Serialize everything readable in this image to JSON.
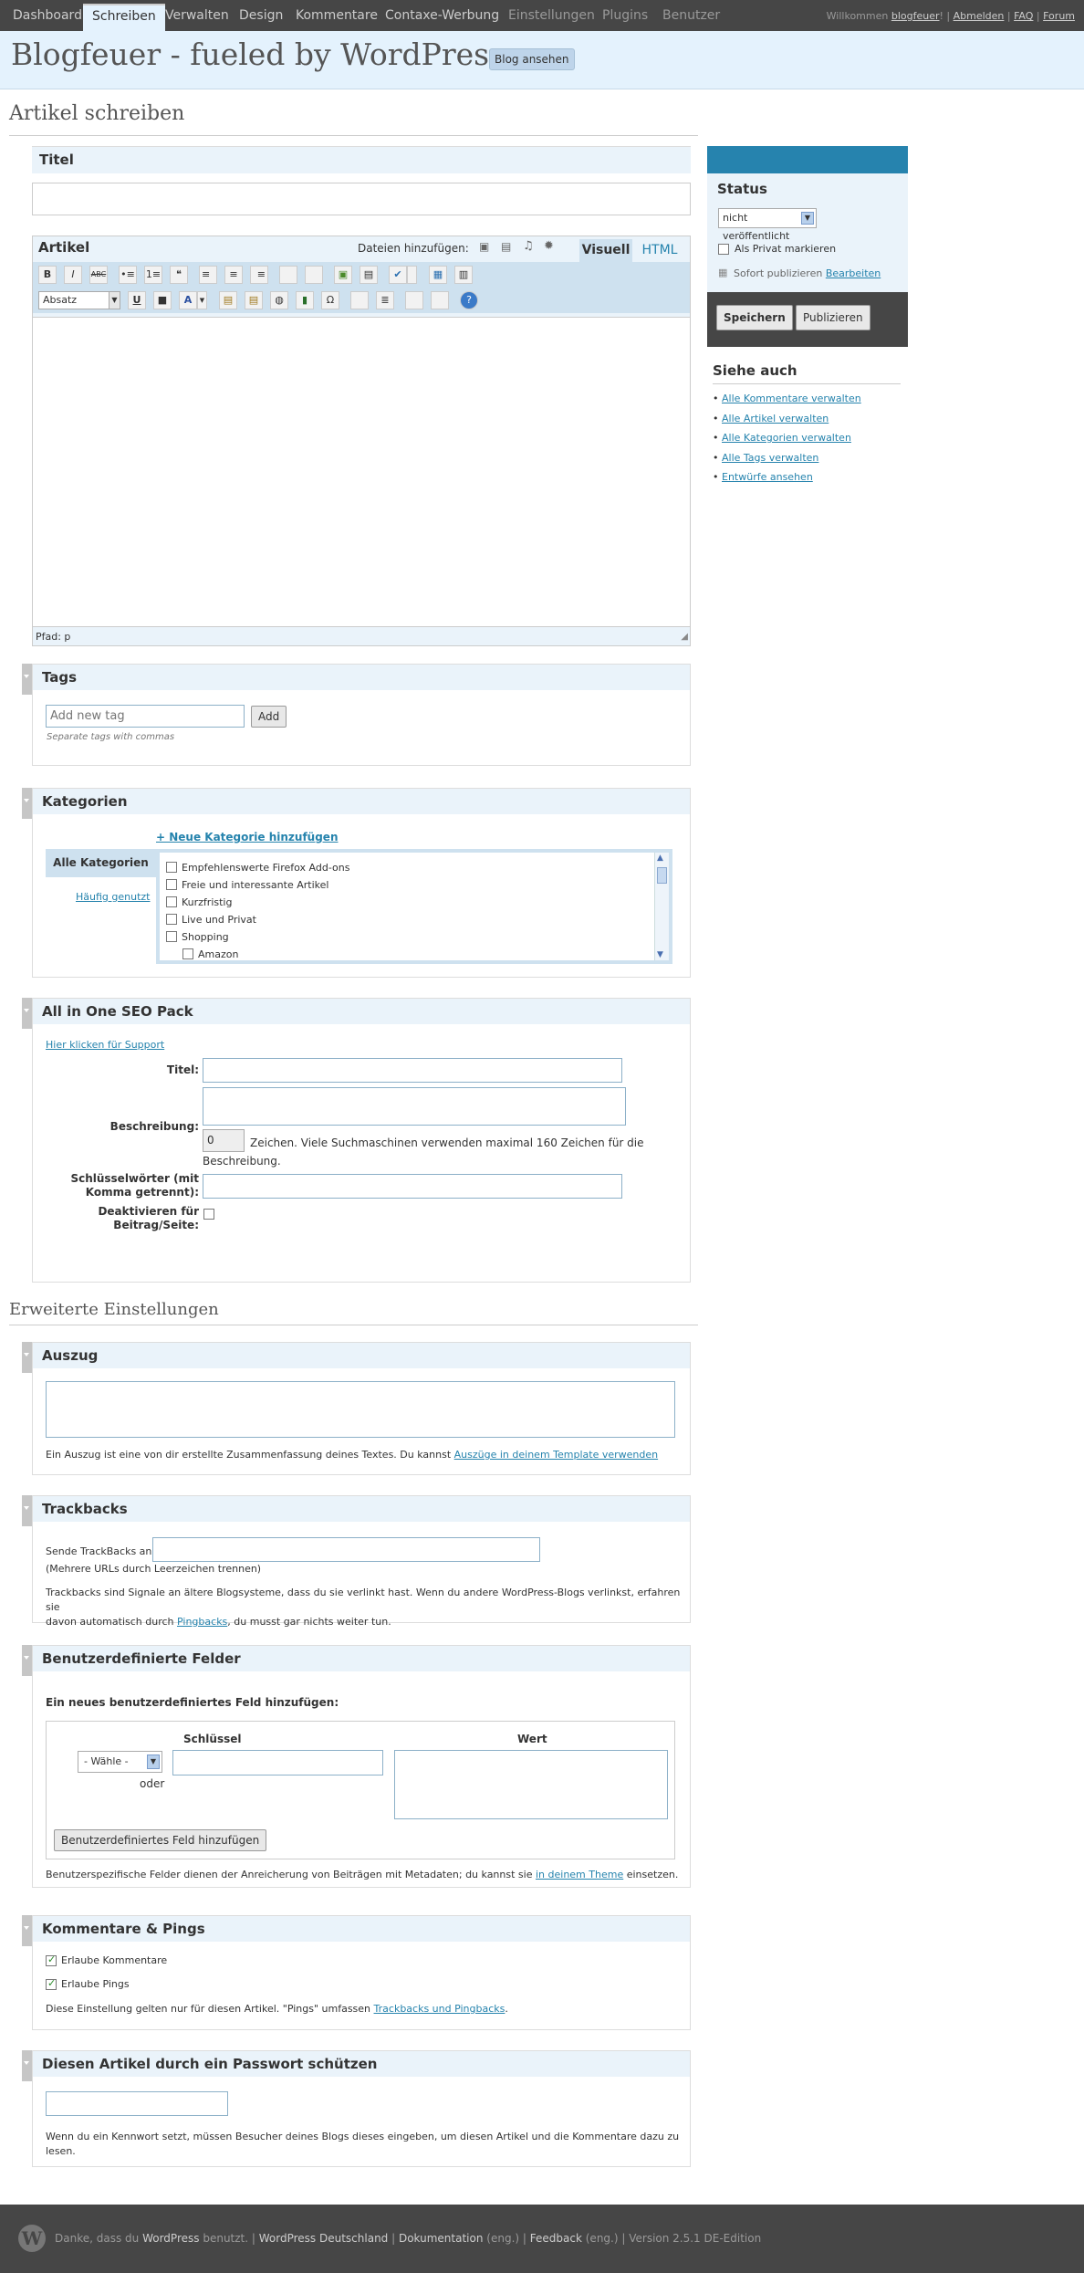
{
  "topnav": {
    "items": [
      "Dashboard",
      "Schreiben",
      "Verwalten",
      "Design",
      "Kommentare",
      "Contaxe-Werbung",
      "Einstellungen",
      "Plugins",
      "Benutzer"
    ],
    "welcome": "Willkommen",
    "user": "blogfeuer",
    "logout": "Abmelden",
    "faq": "FAQ",
    "forum": "Forum"
  },
  "header": {
    "title": "Blogfeuer - fueled by WordPress",
    "view_blog": "Blog ansehen"
  },
  "page": {
    "title": "Artikel schreiben",
    "advanced_title": "Erweiterte Einstellungen"
  },
  "title_box": {
    "label": "Titel",
    "value": ""
  },
  "editor": {
    "label": "Artikel",
    "add_media": "Dateien hinzufügen:",
    "tab_visual": "Visuell",
    "tab_html": "HTML",
    "format": "Absatz",
    "path": "Pfad: p",
    "toolbar1": [
      "B",
      "I",
      "ABC",
      "•≡",
      "1≡",
      "❝",
      "≡",
      "≡",
      "≡",
      "",
      "",
      "▣",
      "▤",
      "✔",
      "",
      "▦"
    ],
    "toolbar2": [
      "U",
      "■",
      "A",
      "▤",
      "▤",
      "◍",
      "Ω",
      "",
      "≣",
      "",
      "",
      "?"
    ]
  },
  "status": {
    "title": "Status",
    "select": "nicht veröffentlicht",
    "private": "Als Privat markieren",
    "publish_now": "Sofort publizieren",
    "edit": "Bearbeiten",
    "save": "Speichern",
    "publish": "Publizieren"
  },
  "see_also": {
    "title": "Siehe auch",
    "links": [
      "Alle Kommentare verwalten",
      "Alle Artikel verwalten",
      "Alle Kategorien verwalten",
      "Alle Tags verwalten",
      "Entwürfe ansehen"
    ]
  },
  "tags": {
    "title": "Tags",
    "placeholder": "Add new tag",
    "add": "Add",
    "hint": "Separate tags with commas"
  },
  "categories": {
    "title": "Kategorien",
    "add_link": "+ Neue Kategorie hinzufügen",
    "tab_all": "Alle Kategorien",
    "tab_popular": "Häufig genutzt",
    "items": [
      "Empfehlenswerte Firefox Add-ons",
      "Freie und interessante Artikel",
      "Kurzfristig",
      "Live und Privat",
      "Shopping",
      "Amazon"
    ]
  },
  "seo": {
    "title": "All in One SEO Pack",
    "support": "Hier klicken für Support",
    "title_label": "Titel:",
    "desc_label": "Beschreibung:",
    "counter": "0",
    "counter_text": "Zeichen. Viele Suchmaschinen verwenden maximal 160 Zeichen für die Beschreibung.",
    "keywords_label": "Schlüsselwörter (mit Komma getrennt):",
    "disable_label": "Deaktivieren für Beitrag/Seite:"
  },
  "excerpt": {
    "title": "Auszug",
    "text": "Ein Auszug ist eine von dir erstellte Zusammenfassung deines Textes. Du kannst",
    "link": "Auszüge in deinem Template verwenden"
  },
  "trackbacks": {
    "title": "Trackbacks",
    "send_label": "Sende TrackBacks an:",
    "hint": "(Mehrere URLs durch Leerzeichen trennen)",
    "text1": "Trackbacks sind Signale an ältere Blogsysteme, dass du sie verlinkt hast. Wenn du andere WordPress-Blogs verlinkst, erfahren sie",
    "text2a": "davon automatisch durch",
    "link": "Pingbacks",
    "text2b": ", du musst gar nichts weiter tun."
  },
  "custom_fields": {
    "title": "Benutzerdefinierte Felder",
    "add_title": "Ein neues benutzerdefiniertes Feld hinzufügen:",
    "col_key": "Schlüssel",
    "col_value": "Wert",
    "select": "- Wähle -",
    "or": "oder",
    "add_button": "Benutzerdefiniertes Feld hinzufügen",
    "text": "Benutzerspezifische Felder dienen der Anreicherung von Beiträgen mit Metadaten; du kannst sie",
    "link": "in deinem Theme",
    "text_end": "einsetzen."
  },
  "comments": {
    "title": "Kommentare & Pings",
    "allow_comments": "Erlaube Kommentare",
    "allow_pings": "Erlaube Pings",
    "text": "Diese Einstellung gelten nur für diesen Artikel. \"Pings\" umfassen",
    "link": "Trackbacks und Pingbacks",
    "dot": "."
  },
  "password": {
    "title": "Diesen Artikel durch ein Passwort schützen",
    "text1": "Wenn du ein Kennwort setzt, müssen Besucher deines Blogs dieses eingeben, um diesen Artikel und die Kommentare dazu zu",
    "text2": "lesen."
  },
  "footer": {
    "thanks": "Danke, dass du",
    "wp": "WordPress",
    "uses": "benutzt.",
    "wpde": "WordPress Deutschland",
    "docs": "Dokumentation",
    "docs_suffix": "(eng.)",
    "feedback": "Feedback",
    "feedback_suffix": "(eng.)",
    "version": "Version 2.5.1 DE-Edition"
  }
}
